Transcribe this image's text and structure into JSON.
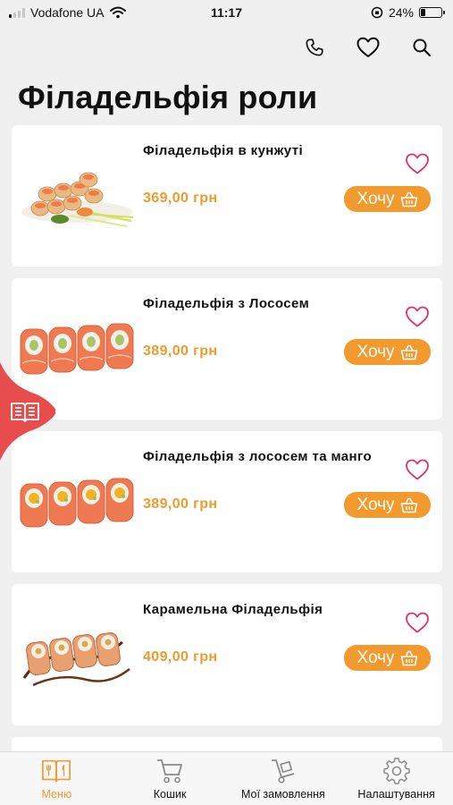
{
  "status_bar": {
    "carrier": "Vodafone UA",
    "time": "11:17",
    "battery_percent": "24%",
    "battery_level": 0.24
  },
  "header": {
    "title": "Філадельфія роли",
    "icons": [
      "phone-icon",
      "heart-icon",
      "search-icon"
    ]
  },
  "products": [
    {
      "name": "Філадельфія в кунжуті",
      "price": "369,00 грн",
      "button_label": "Хочу"
    },
    {
      "name": "Філадельфія з Лососем",
      "price": "389,00 грн",
      "button_label": "Хочу"
    },
    {
      "name": "Філадельфія з лососем та манго",
      "price": "389,00 грн",
      "button_label": "Хочу"
    },
    {
      "name": "Карамельна Філадельфія",
      "price": "409,00 грн",
      "button_label": "Хочу"
    }
  ],
  "tab_bar": {
    "active": "menu",
    "tabs": [
      {
        "label": "Меню",
        "icon": "menu-book-icon"
      },
      {
        "label": "Кошик",
        "icon": "cart-icon"
      },
      {
        "label": "Мої замовлення",
        "icon": "orders-hand-truck-icon"
      },
      {
        "label": "Налаштування",
        "icon": "gear-icon"
      }
    ]
  },
  "colors": {
    "accent": "#f29a2e",
    "heart": "#e0336a",
    "side_tab": "#e84d4d",
    "background": "#f0f0f0"
  }
}
